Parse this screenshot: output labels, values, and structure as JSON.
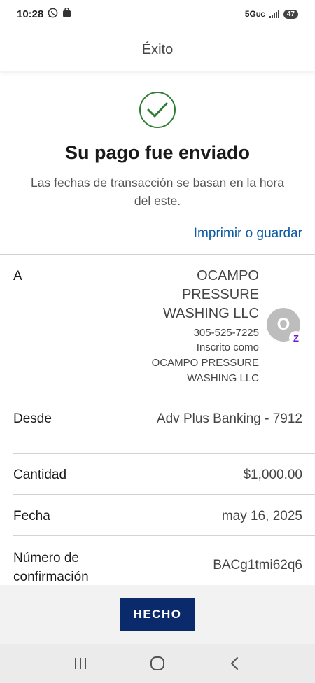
{
  "status_bar": {
    "time": "10:28",
    "network": "5G",
    "network_sub": "UC",
    "battery": "47"
  },
  "header": {
    "title": "Éxito"
  },
  "success": {
    "title": "Su pago fue enviado",
    "subtitle": "Las fechas de transacción se basan en la hora del este."
  },
  "actions": {
    "print_save": "Imprimir o guardar",
    "done": "HECHO"
  },
  "details": {
    "to_label": "A",
    "recipient": {
      "name_line1": "OCAMPO",
      "name_line2": "PRESSURE",
      "name_line3": "WASHING LLC",
      "phone": "305-525-7225",
      "enrolled_label": "Inscrito como",
      "enrolled_name_line1": "OCAMPO PRESSURE",
      "enrolled_name_line2": "WASHING LLC",
      "avatar_initial": "O",
      "badge_icon": "zelle-icon",
      "badge_glyph": "Z"
    },
    "from": {
      "label": "Desde",
      "value": "Adv Plus Banking - 7912"
    },
    "amount": {
      "label": "Cantidad",
      "value": "$1,000.00"
    },
    "date": {
      "label": "Fecha",
      "value": "may 16, 2025"
    },
    "confirmation": {
      "label_line1": "Número de",
      "label_line2": "confirmación",
      "value": "BACg1tmi62q6"
    }
  },
  "colors": {
    "accent_link": "#0b5aa3",
    "button_bg": "#0b2a6b",
    "success_green": "#2e7d32",
    "zelle_purple": "#6d1ed4"
  }
}
